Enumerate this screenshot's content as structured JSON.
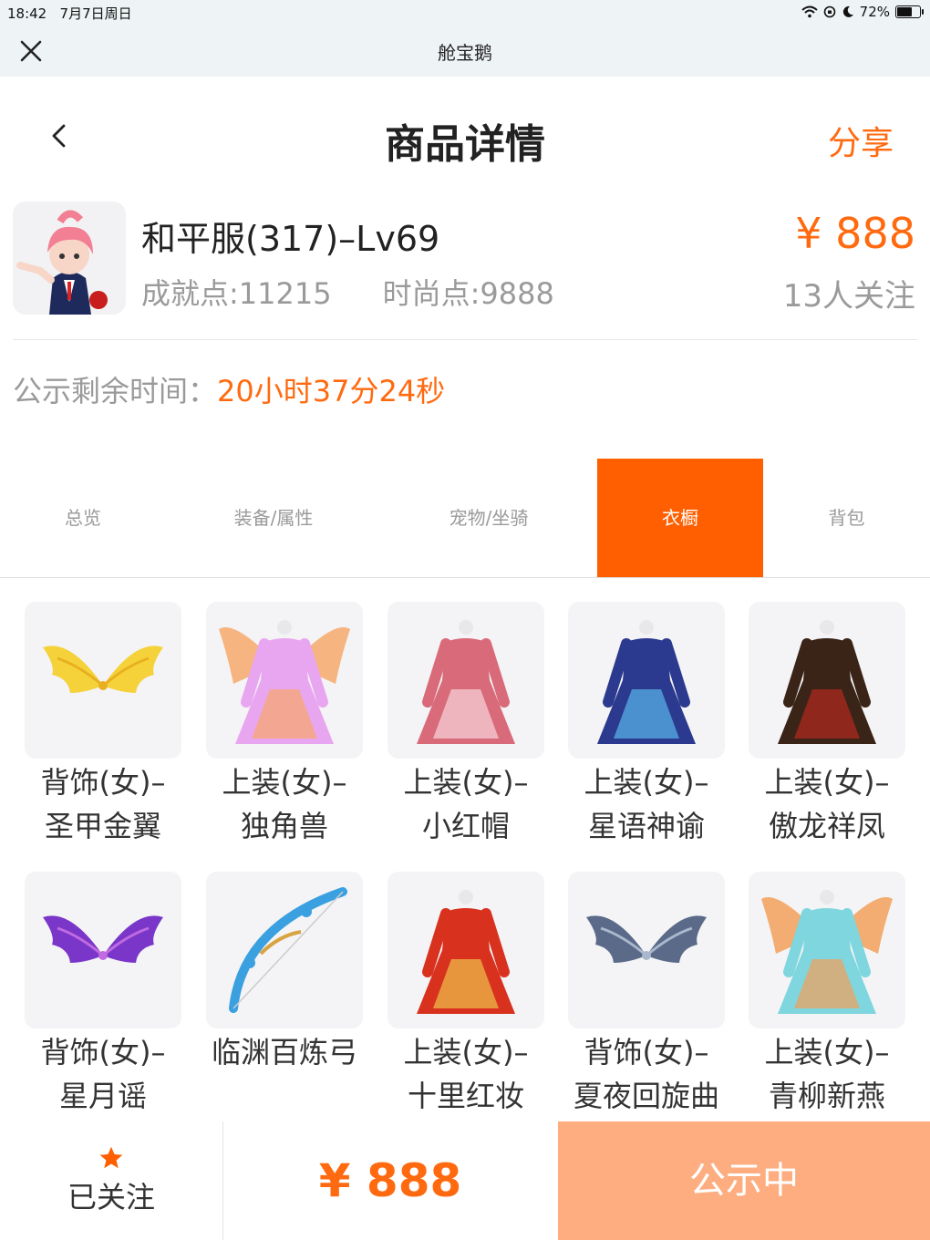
{
  "status_bar": {
    "time": "18:42",
    "date": "7月7日周日",
    "battery": "72%",
    "battery_level": 0.72
  },
  "nav": {
    "title": "舱宝鹅",
    "close_icon": "close-icon"
  },
  "header": {
    "title": "商品详情",
    "share": "分享",
    "back_icon": "chevron-left-icon"
  },
  "product": {
    "name": "和平服(317)–Lv69",
    "achievement": "成就点:11215",
    "fashion": "时尚点:9888",
    "price": "¥ 888",
    "follows": "13人关注"
  },
  "countdown": {
    "label": "公示剩余时间：",
    "value": "20小时37分24秒"
  },
  "tabs": [
    {
      "label": "总览",
      "active": false
    },
    {
      "label": "装备/属性",
      "active": false
    },
    {
      "label": "宠物/坐骑",
      "active": false
    },
    {
      "label": "衣橱",
      "active": true
    },
    {
      "label": "背包",
      "active": false
    }
  ],
  "items": [
    {
      "line1": "背饰(女)–",
      "line2": "圣甲金翼",
      "kind": "wings",
      "colors": [
        "#f5d23a",
        "#e8b020"
      ]
    },
    {
      "line1": "上装(女)–",
      "line2": "独角兽",
      "kind": "dress-wings",
      "colors": [
        "#e9a6f0",
        "#f6a86b"
      ]
    },
    {
      "line1": "上装(女)–",
      "line2": "小红帽",
      "kind": "dress",
      "colors": [
        "#d96a7a",
        "#f6d6dc"
      ]
    },
    {
      "line1": "上装(女)–",
      "line2": "星语神谕",
      "kind": "dress",
      "colors": [
        "#2b3a8f",
        "#5ab6ea"
      ]
    },
    {
      "line1": "上装(女)–",
      "line2": "傲龙祥凤",
      "kind": "dress",
      "colors": [
        "#3a2418",
        "#b3291f"
      ]
    },
    {
      "line1": "背饰(女)–",
      "line2": "星月谣",
      "kind": "wings",
      "colors": [
        "#7a36c9",
        "#c06be0"
      ]
    },
    {
      "line1": "临渊百炼弓",
      "line2": "",
      "kind": "bow",
      "colors": [
        "#3aa0e0",
        "#d8a340"
      ]
    },
    {
      "line1": "上装(女)–",
      "line2": "十里红妆",
      "kind": "dress",
      "colors": [
        "#d8321f",
        "#f0c04a"
      ]
    },
    {
      "line1": "背饰(女)–",
      "line2": "夏夜回旋曲",
      "kind": "wings",
      "colors": [
        "#5a6a88",
        "#a9b8cc"
      ]
    },
    {
      "line1": "上装(女)–",
      "line2": "青柳新燕",
      "kind": "dress-wings",
      "colors": [
        "#7fd6de",
        "#f2a05a"
      ]
    }
  ],
  "bottom": {
    "follow_label": "已关注",
    "price": "¥ 888",
    "status": "公示中",
    "accent": "#ff6a10",
    "status_color": "#fdad80"
  }
}
